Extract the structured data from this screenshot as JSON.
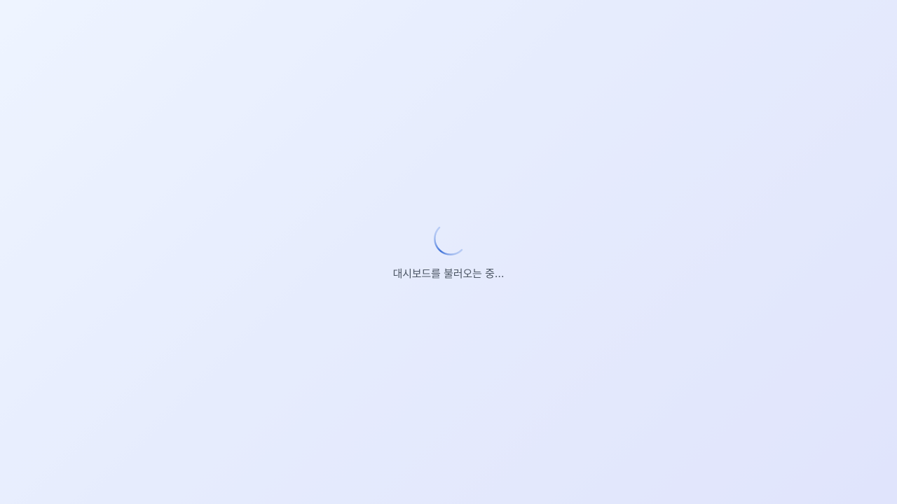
{
  "loading": {
    "message": "대시보드를 불러오는 중...",
    "spinner_icon": "loading-spinner-icon",
    "accent_color": "#3b6fd8"
  }
}
